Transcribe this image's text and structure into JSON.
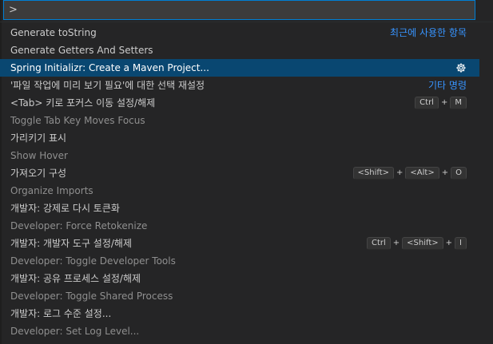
{
  "input": {
    "value": ">",
    "placeholder": ""
  },
  "items": [
    {
      "label": "Generate toString",
      "group_label": "최근에 사용한 항목"
    },
    {
      "label": "Generate Getters And Setters"
    },
    {
      "label": "Spring Initializr: Create a Maven Project...",
      "selected": true,
      "icon": "gear-icon"
    },
    {
      "label": "'파일 작업에 미리 보기 필요'에 대한 선택 재설정",
      "group_label": "기타 명령"
    },
    {
      "label": "<Tab> 키로 포커스 이동 설정/해제",
      "detail": "Toggle Tab Key Moves Focus",
      "keys": [
        "Ctrl",
        "M"
      ]
    },
    {
      "label": "가리키기 표시",
      "detail": "Show Hover"
    },
    {
      "label": "가져오기 구성",
      "detail": "Organize Imports",
      "keys": [
        "<Shift>",
        "<Alt>",
        "O"
      ]
    },
    {
      "label": "개발자: 강제로 다시 토큰화",
      "detail": "Developer: Force Retokenize"
    },
    {
      "label": "개발자: 개발자 도구 설정/해제",
      "detail": "Developer: Toggle Developer Tools",
      "keys": [
        "Ctrl",
        "<Shift>",
        "I"
      ]
    },
    {
      "label": "개발자: 공유 프로세스 설정/해제",
      "detail": "Developer: Toggle Shared Process"
    },
    {
      "label": "개발자: 로그 수준 설정...",
      "detail": "Developer: Set Log Level..."
    }
  ],
  "plus_sign": "+",
  "colors": {
    "accent": "#3794ff",
    "selection": "#094771",
    "background": "#252526"
  }
}
